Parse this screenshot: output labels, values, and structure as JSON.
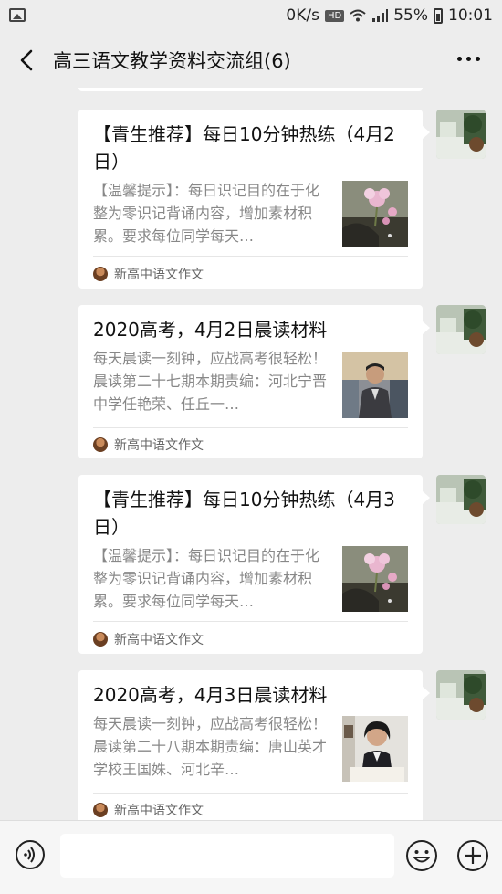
{
  "status_bar": {
    "speed": "0K/s",
    "hd": "HD",
    "battery": "55%",
    "time": "10:01"
  },
  "header": {
    "title": "高三语文教学资料交流组(6)"
  },
  "messages": [
    {
      "title": "【青生推荐】每日10分钟热练（4月2日）",
      "desc": "【温馨提示】：每日识记目的在于化整为零识记背诵内容，增加素材积累。要求每位同学每天…",
      "source": "新高中语文作文",
      "thumb": "flower"
    },
    {
      "title": "2020高考，4月2日晨读材料",
      "desc": "每天晨读一刻钟，应战高考很轻松！晨读第二十七期本期责编：河北宁晋中学任艳荣、任丘一…",
      "source": "新高中语文作文",
      "thumb": "teacher-man"
    },
    {
      "title": "【青生推荐】每日10分钟热练（4月3日）",
      "desc": "【温馨提示】：每日识记目的在于化整为零识记背诵内容，增加素材积累。要求每位同学每天…",
      "source": "新高中语文作文",
      "thumb": "flower"
    },
    {
      "title": "2020高考，4月3日晨读材料",
      "desc": "每天晨读一刻钟，应战高考很轻松！晨读第二十八期本期责编：唐山英才学校王国姝、河北辛…",
      "source": "新高中语文作文",
      "thumb": "teacher-woman"
    }
  ],
  "icons": {
    "back": "chevron-left-icon",
    "more": "more-dots-icon",
    "voice": "voice-icon",
    "emoji": "emoji-icon",
    "plus": "plus-icon"
  }
}
